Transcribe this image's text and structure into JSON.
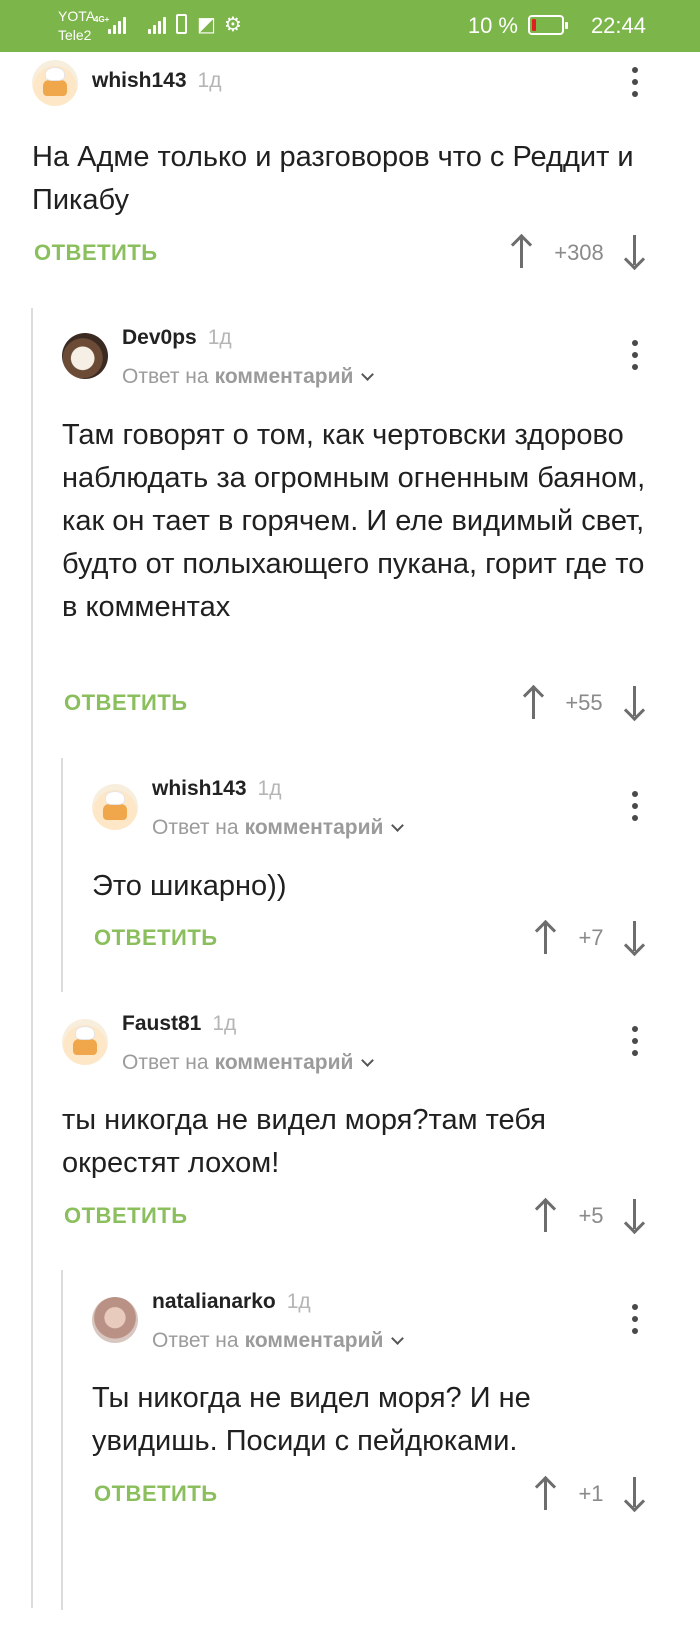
{
  "status_bar": {
    "carrier1": "YOTA",
    "network1": "4G+",
    "carrier2": "Tele2",
    "battery": "10 %",
    "time": "22:44"
  },
  "comments": [
    {
      "username": "whish143",
      "age": "1д",
      "text": "На Адме только и разговоров что с Реддит и Пикабу",
      "reply": "ОТВЕТИТЬ",
      "score": "+308"
    },
    {
      "username": "Dev0ps",
      "age": "1д",
      "reply_to_prefix": "Ответ на",
      "reply_to_target": "комментарий",
      "text": "Там говорят о том, как чертовски здорово наблюдать за огромным огненным баяном, как он тает в горячем. И еле видимый свет, будто от полыхающего пукана, горит где то в комментах",
      "reply": "ОТВЕТИТЬ",
      "score": "+55"
    },
    {
      "username": "whish143",
      "age": "1д",
      "reply_to_prefix": "Ответ на",
      "reply_to_target": "комментарий",
      "text": "Это шикарно))",
      "reply": "ОТВЕТИТЬ",
      "score": "+7"
    },
    {
      "username": "Faust81",
      "age": "1д",
      "reply_to_prefix": "Ответ на",
      "reply_to_target": "комментарий",
      "text": "ты никогда не видел моря?там тебя окрестят лохом!",
      "reply": "ОТВЕТИТЬ",
      "score": "+5"
    },
    {
      "username": "natalianarko",
      "age": "1д",
      "reply_to_prefix": "Ответ на",
      "reply_to_target": "комментарий",
      "text": "Ты никогда не видел моря? И не увидишь. Посиди с пейдюками.",
      "reply": "ОТВЕТИТЬ",
      "score": "+1"
    }
  ],
  "colors": {
    "status_bar": "#7cb54a",
    "reply_button": "#8bbf5d"
  }
}
